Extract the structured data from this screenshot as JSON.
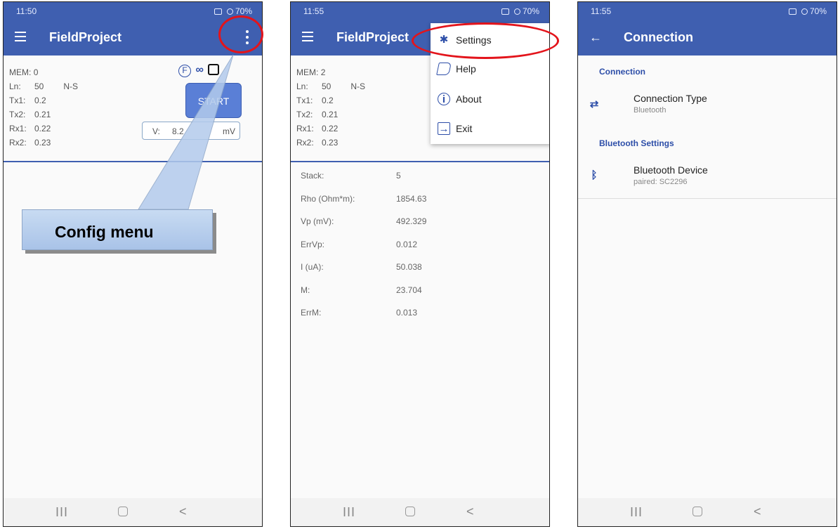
{
  "phone1": {
    "status_time": "11:50",
    "status_right": "70%",
    "title": "FieldProject",
    "mem": {
      "label": "MEM:",
      "value": "0"
    },
    "ln": {
      "label": "Ln:",
      "value": "50",
      "direction": "N-S"
    },
    "tx1": {
      "label": "Tx1:",
      "value": "0.2"
    },
    "tx2": {
      "label": "Tx2:",
      "value": "0.21"
    },
    "rx1": {
      "label": "Rx1:",
      "value": "0.22"
    },
    "rx2": {
      "label": "Rx2:",
      "value": "0.23"
    },
    "f_badge": "F",
    "start_label": "START",
    "voltage": {
      "label": "V:",
      "value": "8.2",
      "unit": "mV"
    },
    "callout_text": "Config menu"
  },
  "phone2": {
    "status_time": "11:55",
    "status_right": "70%",
    "title": "FieldProject",
    "mem": {
      "label": "MEM:",
      "value": "2"
    },
    "ln": {
      "label": "Ln:",
      "value": "50",
      "direction": "N-S"
    },
    "tx1": {
      "label": "Tx1:",
      "value": "0.2"
    },
    "tx2": {
      "label": "Tx2:",
      "value": "0.21"
    },
    "rx1": {
      "label": "Rx1:",
      "value": "0.22"
    },
    "rx2": {
      "label": "Rx2:",
      "value": "0.23"
    },
    "menu": {
      "settings": "Settings",
      "help": "Help",
      "about": "About",
      "exit": "Exit"
    },
    "results": [
      {
        "label": "Stack:",
        "value": "5"
      },
      {
        "label": "Rho (Ohm*m):",
        "value": "1854.63"
      },
      {
        "label": "Vp (mV):",
        "value": "492.329"
      },
      {
        "label": "ErrVp:",
        "value": "0.012"
      },
      {
        "label": "I (uA):",
        "value": "50.038"
      },
      {
        "label": "M:",
        "value": "23.704"
      },
      {
        "label": "ErrM:",
        "value": "0.013"
      }
    ]
  },
  "phone3": {
    "status_time": "11:55",
    "status_right": "70%",
    "title": "Connection",
    "section_connection": "Connection",
    "connection_type": {
      "title": "Connection Type",
      "summary": "Bluetooth"
    },
    "section_bluetooth": "Bluetooth Settings",
    "bluetooth_device": {
      "title": "Bluetooth Device",
      "summary": "paired: SC2296"
    }
  },
  "nav": {
    "recent": "III",
    "back": "<"
  },
  "colors": {
    "primary": "#3f5fb0",
    "accent": "#2d4ea8",
    "annotation": "#e3141b"
  },
  "icons": [
    "menu-icon",
    "more-vert-icon",
    "back-arrow-icon",
    "gear-icon",
    "help-book-icon",
    "info-icon",
    "exit-icon",
    "swap-arrows-icon",
    "bluetooth-icon"
  ]
}
